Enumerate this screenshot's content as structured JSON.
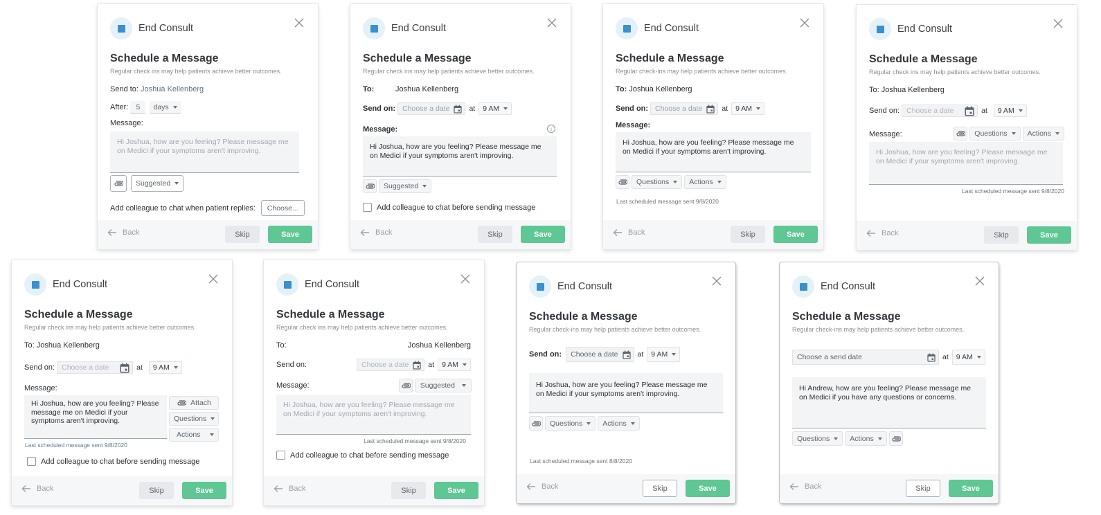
{
  "common": {
    "header_title": "End Consult",
    "heading": "Schedule a Message",
    "back_label": "Back",
    "skip_label": "Skip",
    "save_label": "Save",
    "at_label": "at",
    "time_value": "9 AM",
    "date_placeholder": "Choose a date",
    "patient_name": "Joshua Kellenberg",
    "message_joshua": "Hi Joshua, how are you feeling? Please message me on Medici if your symptoms aren't improving.",
    "questions_label": "Questions",
    "actions_label": "Actions",
    "suggested_label": "Suggested",
    "attach_label": "Attach",
    "message_label": "Message:",
    "to_label": "To:",
    "send_on_label": "Send on:",
    "add_colleague_label": "Add colleague to chat before sending message"
  },
  "colors": {
    "save_green": "#5ec793",
    "brand_blue": "#3a8fcd",
    "icon_circle": "#e4f1f8"
  },
  "variants": [
    {
      "subtitle": "Regular check ins may help patients achieve better outcomes.",
      "send_to_label": "Send to:",
      "after_label": "After:",
      "after_value": "5",
      "after_unit": "days",
      "message_label": "Message:",
      "colleague_label": "Add colleague to chat when patient replies:",
      "choose_label": "Choose..."
    },
    {
      "subtitle": "Regular check ins may help patients achieve better outcomes.",
      "info_icon": "i",
      "checkbox_checked": false
    },
    {
      "subtitle": "Regular check-ins may help patients achieve better outcomes.",
      "last_sent": "Last scheduled message sent 9/8/2020"
    },
    {
      "subtitle": "Regular check ins may help patients achieve better outcomes.",
      "last_sent": "Last scheduled message sent 9/8/2020"
    },
    {
      "subtitle": "Regular check ins may help patients achieve better outcomes.",
      "message_lines": "Hi Joshua, how are you feeling? Please message me on Medici if your symptoms aren't improving.",
      "last_sent": "Last scheduled message sent 9/8/2020",
      "checkbox_checked": false
    },
    {
      "subtitle": "Regular check ins may help patients achieve better outcomes.",
      "last_sent": "Last scheduled message sent 9/8/2020",
      "checkbox_checked": false
    },
    {
      "subtitle": "Regular check-ins may help patients achieve better outcomes.",
      "last_sent": "Last scheduled message sent 8/8/2020"
    },
    {
      "subtitle": "Regular check-ins may help patients achieve better outcomes.",
      "date_placeholder": "Choose a send date",
      "message": "Hi Andrew, how are you feeling? Please message me on Medici if you have any questions or concerns."
    }
  ]
}
